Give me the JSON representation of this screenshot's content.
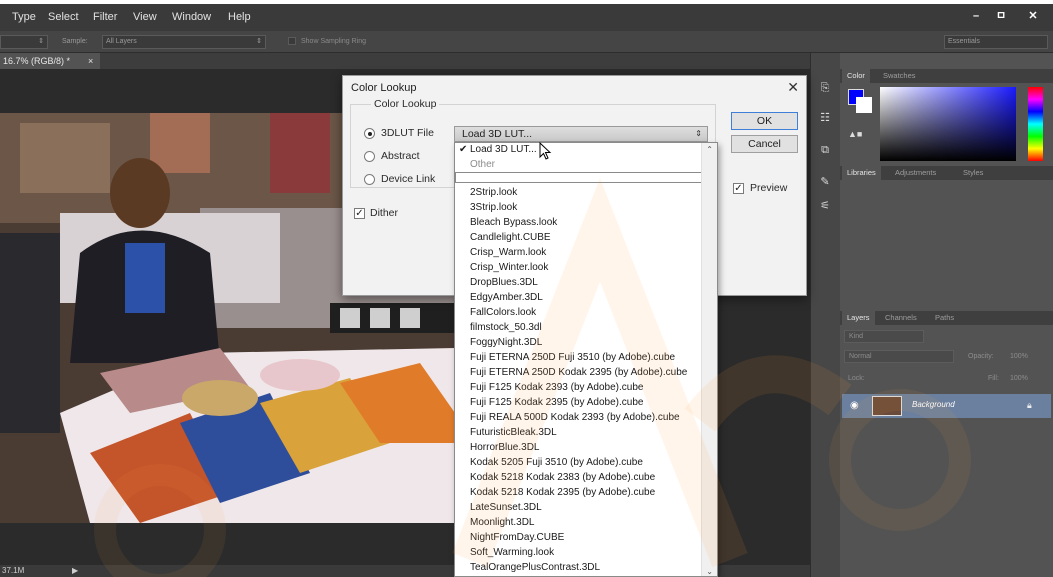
{
  "menu": {
    "items": [
      "Type",
      "Select",
      "Filter",
      "View",
      "Window",
      "Help"
    ],
    "window_buttons": [
      "–",
      "ㅁ",
      "✕"
    ]
  },
  "options": {
    "sample_label": "Sample:",
    "sample_value": "All Layers",
    "show_ring": "Show Sampling Ring",
    "workspace": "Essentials"
  },
  "doc": {
    "tab_label": "16.7% (RGB/8) *",
    "tab_close": "×",
    "status_size": "37.1M",
    "status_arrow": "▶"
  },
  "dialog": {
    "title": "Color Lookup",
    "close": "✕",
    "group_label": "Color Lookup",
    "radios": [
      {
        "label": "3DLUT File",
        "selected": true
      },
      {
        "label": "Abstract",
        "selected": false
      },
      {
        "label": "Device Link",
        "selected": false
      }
    ],
    "dither_label": "Dither",
    "dither_checked": true,
    "select_value": "Load 3D LUT...",
    "ok_label": "OK",
    "cancel_label": "Cancel",
    "preview_label": "Preview",
    "preview_checked": true
  },
  "dropdown": {
    "header_items": [
      {
        "label": "Load 3D LUT...",
        "checked": true,
        "disabled": false
      },
      {
        "label": "Other",
        "checked": false,
        "disabled": true
      }
    ],
    "items": [
      "2Strip.look",
      "3Strip.look",
      "Bleach Bypass.look",
      "Candlelight.CUBE",
      "Crisp_Warm.look",
      "Crisp_Winter.look",
      "DropBlues.3DL",
      "EdgyAmber.3DL",
      "FallColors.look",
      "filmstock_50.3dl",
      "FoggyNight.3DL",
      "Fuji ETERNA 250D Fuji 3510 (by Adobe).cube",
      "Fuji ETERNA 250D Kodak 2395 (by Adobe).cube",
      "Fuji F125 Kodak 2393 (by Adobe).cube",
      "Fuji F125 Kodak 2395 (by Adobe).cube",
      "Fuji REALA 500D Kodak 2393 (by Adobe).cube",
      "FuturisticBleak.3DL",
      "HorrorBlue.3DL",
      "Kodak 5205 Fuji 3510 (by Adobe).cube",
      "Kodak 5218 Kodak 2383 (by Adobe).cube",
      "Kodak 5218 Kodak 2395 (by Adobe).cube",
      "LateSunset.3DL",
      "Moonlight.3DL",
      "NightFromDay.CUBE",
      "Soft_Warming.look",
      "TealOrangePlusContrast.3DL"
    ]
  },
  "panels": {
    "color_tabs": [
      "Color",
      "Swatches"
    ],
    "library_tabs": [
      "Libraries",
      "Adjustments",
      "Styles"
    ],
    "layer_tabs": [
      "Layers",
      "Channels",
      "Paths"
    ],
    "kind_label": "Kind",
    "blend_mode": "Normal",
    "opacity_label": "Opacity:",
    "opacity_value": "100%",
    "lock_label": "Lock:",
    "fill_label": "Fill:",
    "fill_value": "100%",
    "layer_name": "Background"
  },
  "colors": {
    "foreground": "#0000ff",
    "background": "#ffffff",
    "ok_border": "#3f7fd8"
  }
}
